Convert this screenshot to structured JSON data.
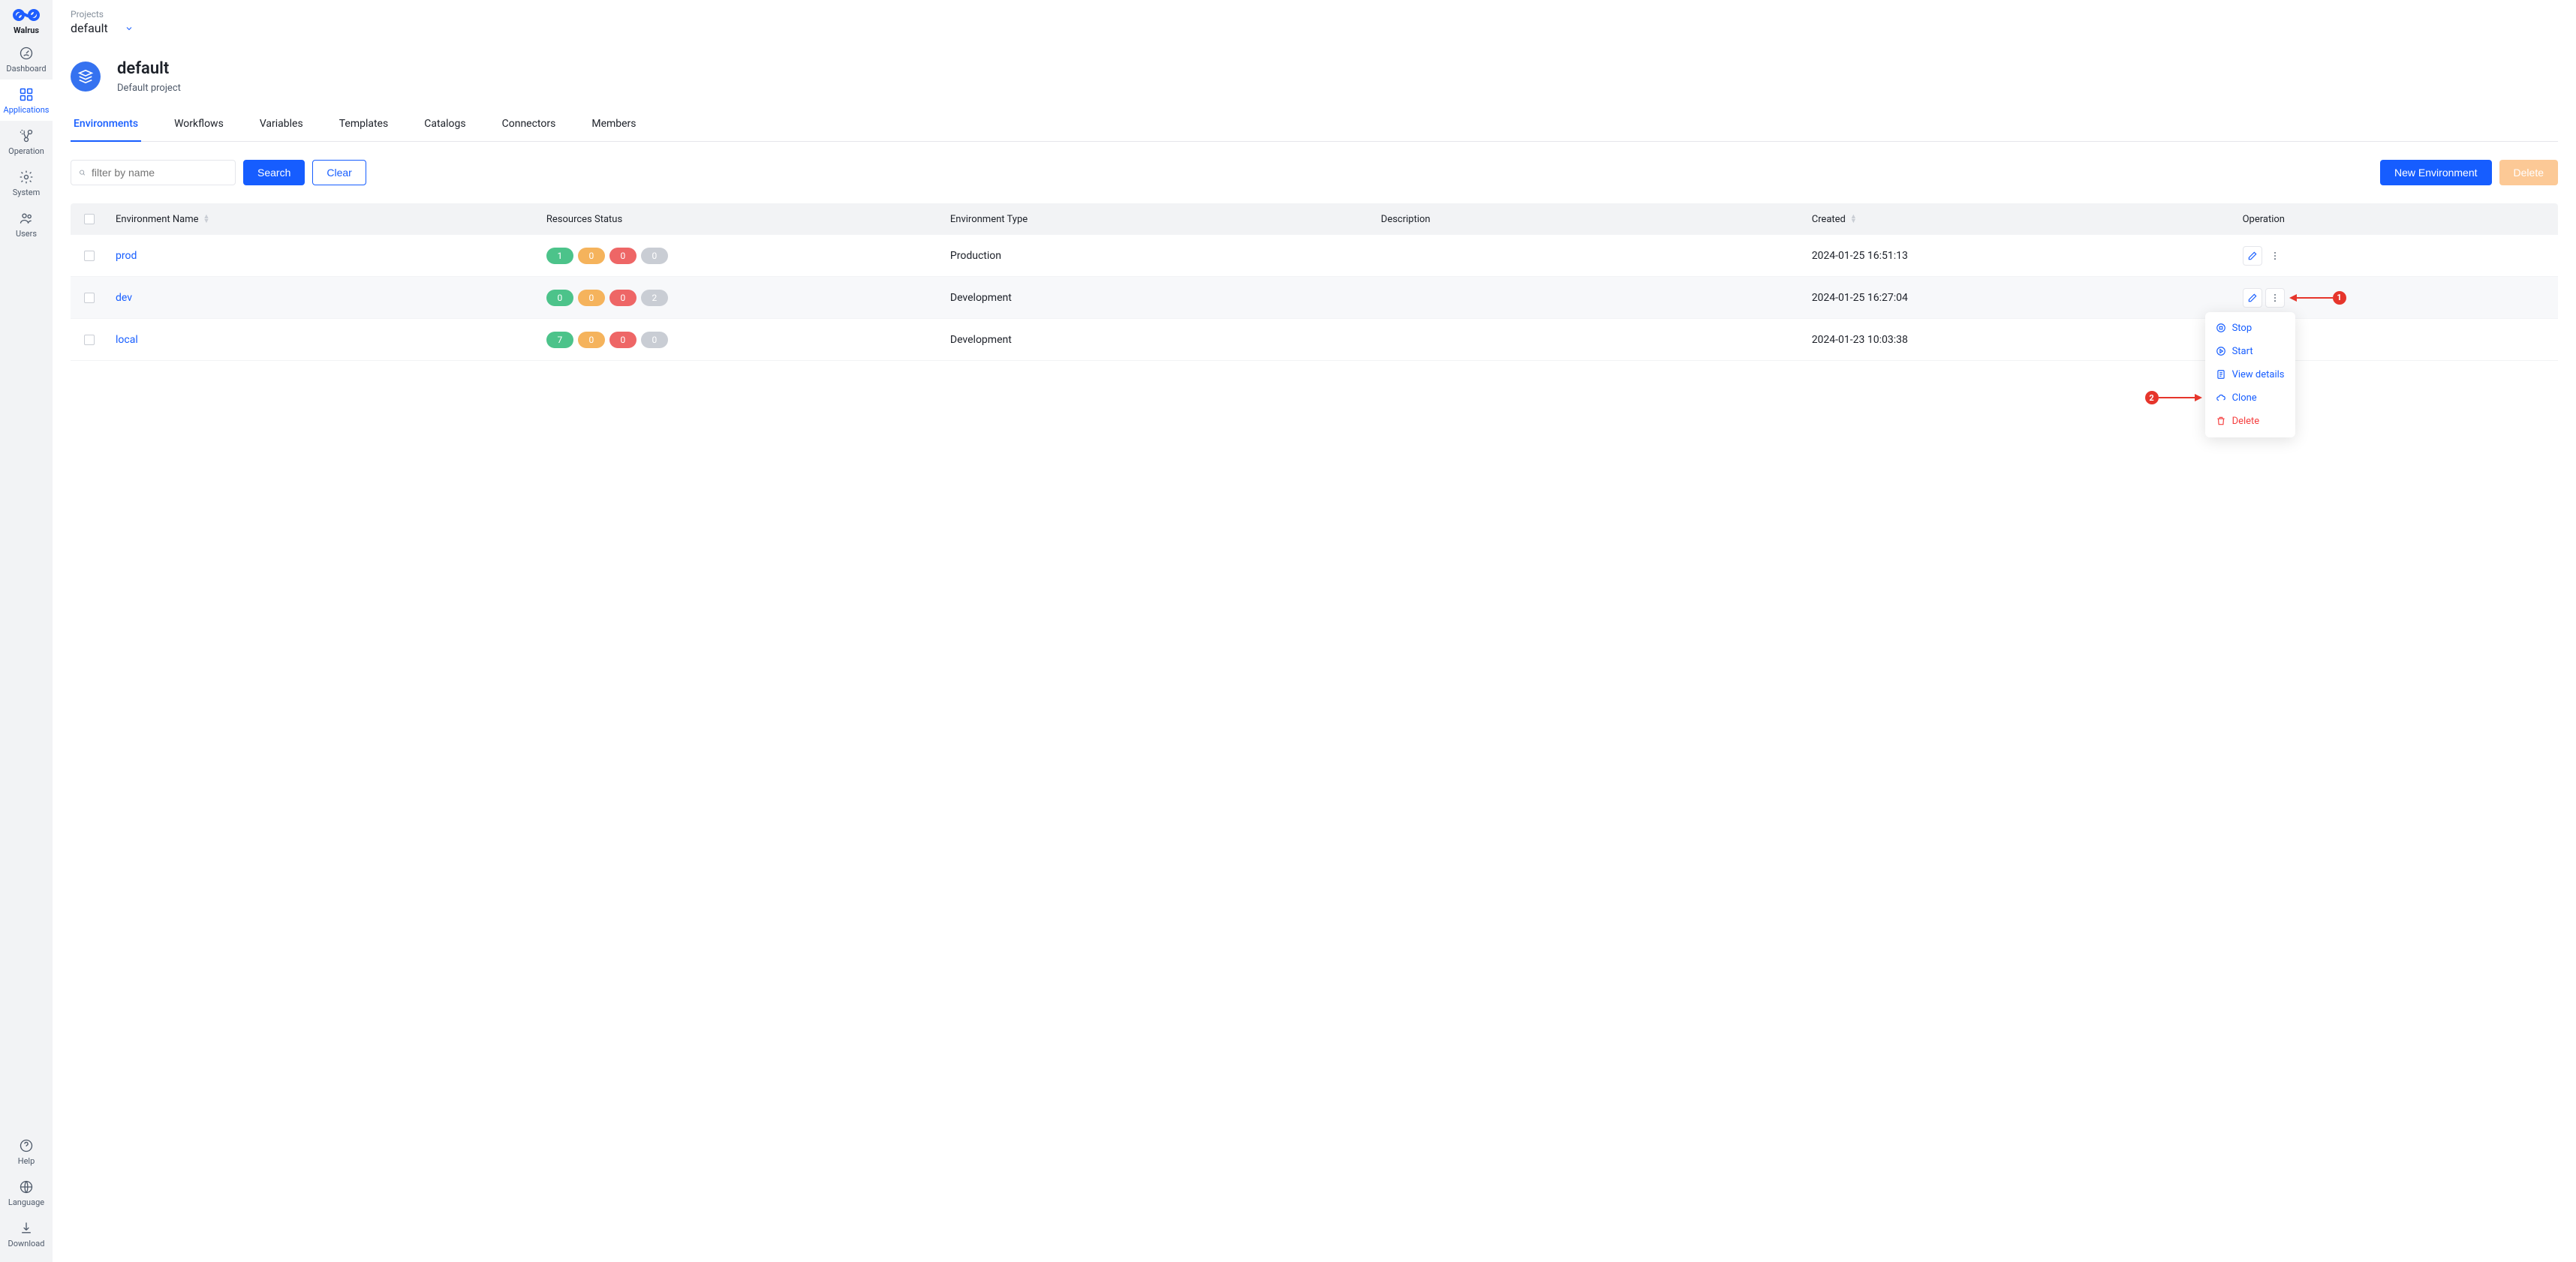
{
  "brand": {
    "name": "Walrus"
  },
  "sidebar": {
    "items": [
      {
        "label": "Dashboard"
      },
      {
        "label": "Applications"
      },
      {
        "label": "Operation"
      },
      {
        "label": "System"
      },
      {
        "label": "Users"
      }
    ],
    "bottom": [
      {
        "label": "Help"
      },
      {
        "label": "Language"
      },
      {
        "label": "Download"
      }
    ]
  },
  "breadcrumb": {
    "root": "Projects"
  },
  "project": {
    "switcher_name": "default",
    "title": "default",
    "subtitle": "Default project"
  },
  "tabs": [
    {
      "label": "Environments"
    },
    {
      "label": "Workflows"
    },
    {
      "label": "Variables"
    },
    {
      "label": "Templates"
    },
    {
      "label": "Catalogs"
    },
    {
      "label": "Connectors"
    },
    {
      "label": "Members"
    }
  ],
  "toolbar": {
    "filter_placeholder": "filter by name",
    "search_label": "Search",
    "clear_label": "Clear",
    "new_label": "New Environment",
    "delete_label": "Delete"
  },
  "table": {
    "headers": {
      "name": "Environment Name",
      "resources": "Resources Status",
      "type": "Environment Type",
      "description": "Description",
      "created": "Created",
      "operation": "Operation"
    },
    "rows": [
      {
        "name": "prod",
        "badges": {
          "green": "1",
          "orange": "0",
          "red": "0",
          "gray": "0"
        },
        "type": "Production",
        "description": "",
        "created": "2024-01-25 16:51:13"
      },
      {
        "name": "dev",
        "badges": {
          "green": "0",
          "orange": "0",
          "red": "0",
          "gray": "2"
        },
        "type": "Development",
        "description": "",
        "created": "2024-01-25 16:27:04"
      },
      {
        "name": "local",
        "badges": {
          "green": "7",
          "orange": "0",
          "red": "0",
          "gray": "0"
        },
        "type": "Development",
        "description": "",
        "created": "2024-01-23 10:03:38"
      }
    ]
  },
  "dropdown": {
    "stop": "Stop",
    "start": "Start",
    "view": "View details",
    "clone": "Clone",
    "delete": "Delete"
  },
  "annotations": {
    "one": "1",
    "two": "2"
  }
}
